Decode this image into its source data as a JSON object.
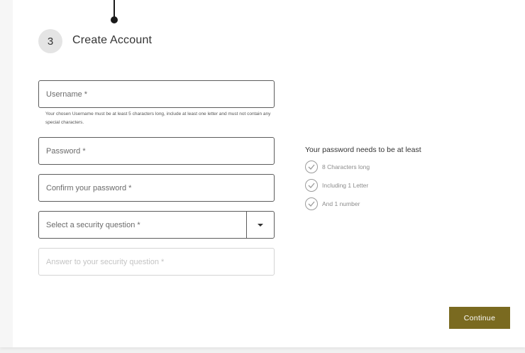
{
  "step": {
    "number": "3",
    "title": "Create Account"
  },
  "form": {
    "username_placeholder": "Username *",
    "username_hint": "Your chosen Username must be at least 5 characters long, include at least one letter and must not contain any special characters.",
    "password_placeholder": "Password *",
    "confirm_placeholder": "Confirm your password *",
    "security_question_placeholder": "Select a security question *",
    "answer_placeholder": "Answer to your security question *"
  },
  "password_rules": {
    "title": "Your password needs to be at least",
    "items": [
      {
        "label": "8 Characters long",
        "icon": "check-circle-icon"
      },
      {
        "label": "Including 1 Letter",
        "icon": "check-circle-icon"
      },
      {
        "label": "And 1 number",
        "icon": "check-circle-icon"
      }
    ]
  },
  "actions": {
    "continue_label": "Continue"
  },
  "colors": {
    "accent": "#7a6a20",
    "field_border": "#5c5c5c",
    "disabled_border": "#d4d4d4"
  }
}
